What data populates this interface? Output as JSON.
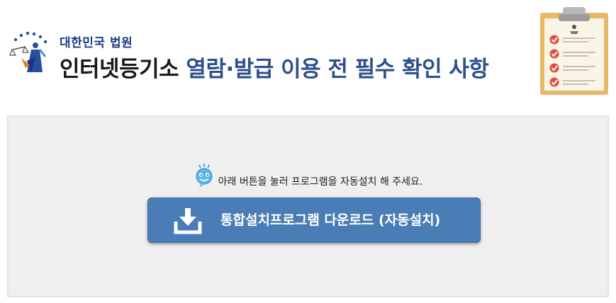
{
  "header": {
    "court_name": "대한민국 법원",
    "title_dark": "인터넷등기소",
    "title_blue": "열람·발급 이용 전 필수 확인 사항"
  },
  "logo_icon": "court-emblem-icon",
  "clipboard_icon": "checklist-clipboard-icon",
  "notice": {
    "text": "아래 버튼을 눌러 프로그램을 자동설치 해 주세요.",
    "icon": "smiley-face-icon"
  },
  "download_button": {
    "label": "통합설치프로그램 다운로드 (자동설치)",
    "icon": "download-icon",
    "color": "#4a7db5"
  },
  "colors": {
    "title_blue": "#2d4f8b",
    "panel_bg": "#efefef"
  }
}
